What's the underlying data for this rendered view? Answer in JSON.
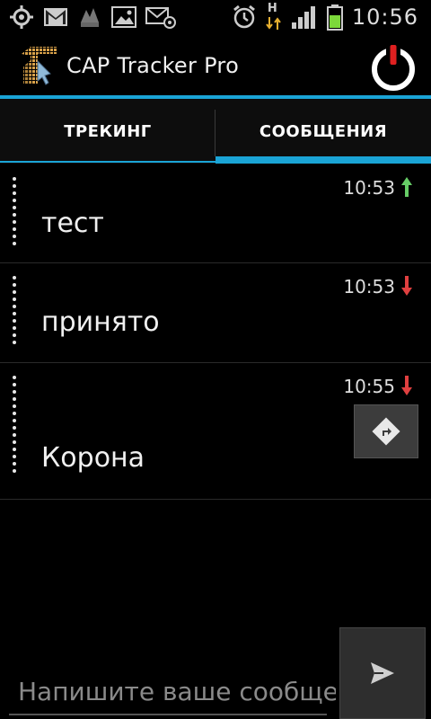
{
  "status_bar": {
    "time": "10:56",
    "network_label": "H",
    "icons": [
      "gps-icon",
      "gmail-icon",
      "app-icon",
      "gallery-icon",
      "email-icon",
      "alarm-icon",
      "network-icon",
      "signal-icon",
      "battery-icon"
    ]
  },
  "app": {
    "title": "CAP Tracker Pro",
    "accent_color": "#1aa4d6"
  },
  "tabs": [
    {
      "label": "ТРЕКИНГ",
      "selected": false
    },
    {
      "label": "СООБЩЕНИЯ",
      "selected": true
    }
  ],
  "messages": [
    {
      "text": "тест",
      "time": "10:53",
      "direction": "outgoing",
      "arrow_color": "#66cc66"
    },
    {
      "text": "принято",
      "time": "10:53",
      "direction": "incoming",
      "arrow_color": "#e04040"
    },
    {
      "text": "Корона",
      "time": "10:55",
      "direction": "incoming",
      "arrow_color": "#e04040"
    }
  ],
  "composer": {
    "placeholder": "Напишите ваше сообщение",
    "value": ""
  }
}
